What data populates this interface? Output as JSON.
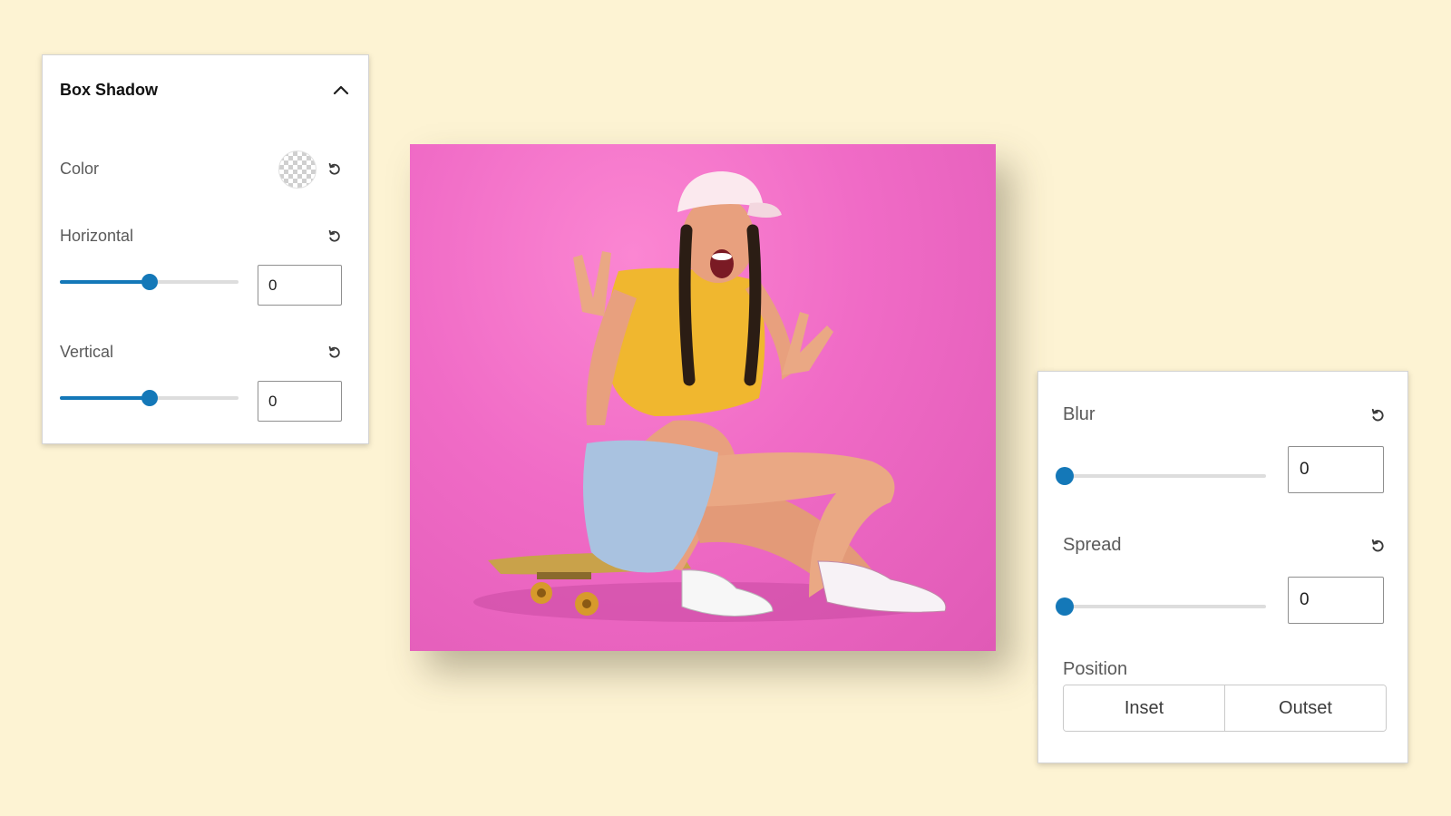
{
  "box_shadow_panel": {
    "title": "Box Shadow",
    "color": {
      "label": "Color",
      "value": "transparent"
    },
    "horizontal": {
      "label": "Horizontal",
      "value": "0",
      "slider_fraction": 0.5
    },
    "vertical": {
      "label": "Vertical",
      "value": "0",
      "slider_fraction": 0.5
    }
  },
  "blur_panel": {
    "blur": {
      "label": "Blur",
      "value": "0",
      "slider_fraction": 0
    },
    "spread": {
      "label": "Spread",
      "value": "0",
      "slider_fraction": 0
    },
    "position": {
      "label": "Position",
      "options": [
        "Inset",
        "Outset"
      ]
    }
  },
  "colors": {
    "background": "#fdf3d3",
    "accent": "#1478b8",
    "photo_backdrop": "#f06bc6"
  },
  "icons": {
    "collapse": "chevron-up-icon",
    "reset": "reset-icon",
    "swatch": "color-swatch"
  }
}
